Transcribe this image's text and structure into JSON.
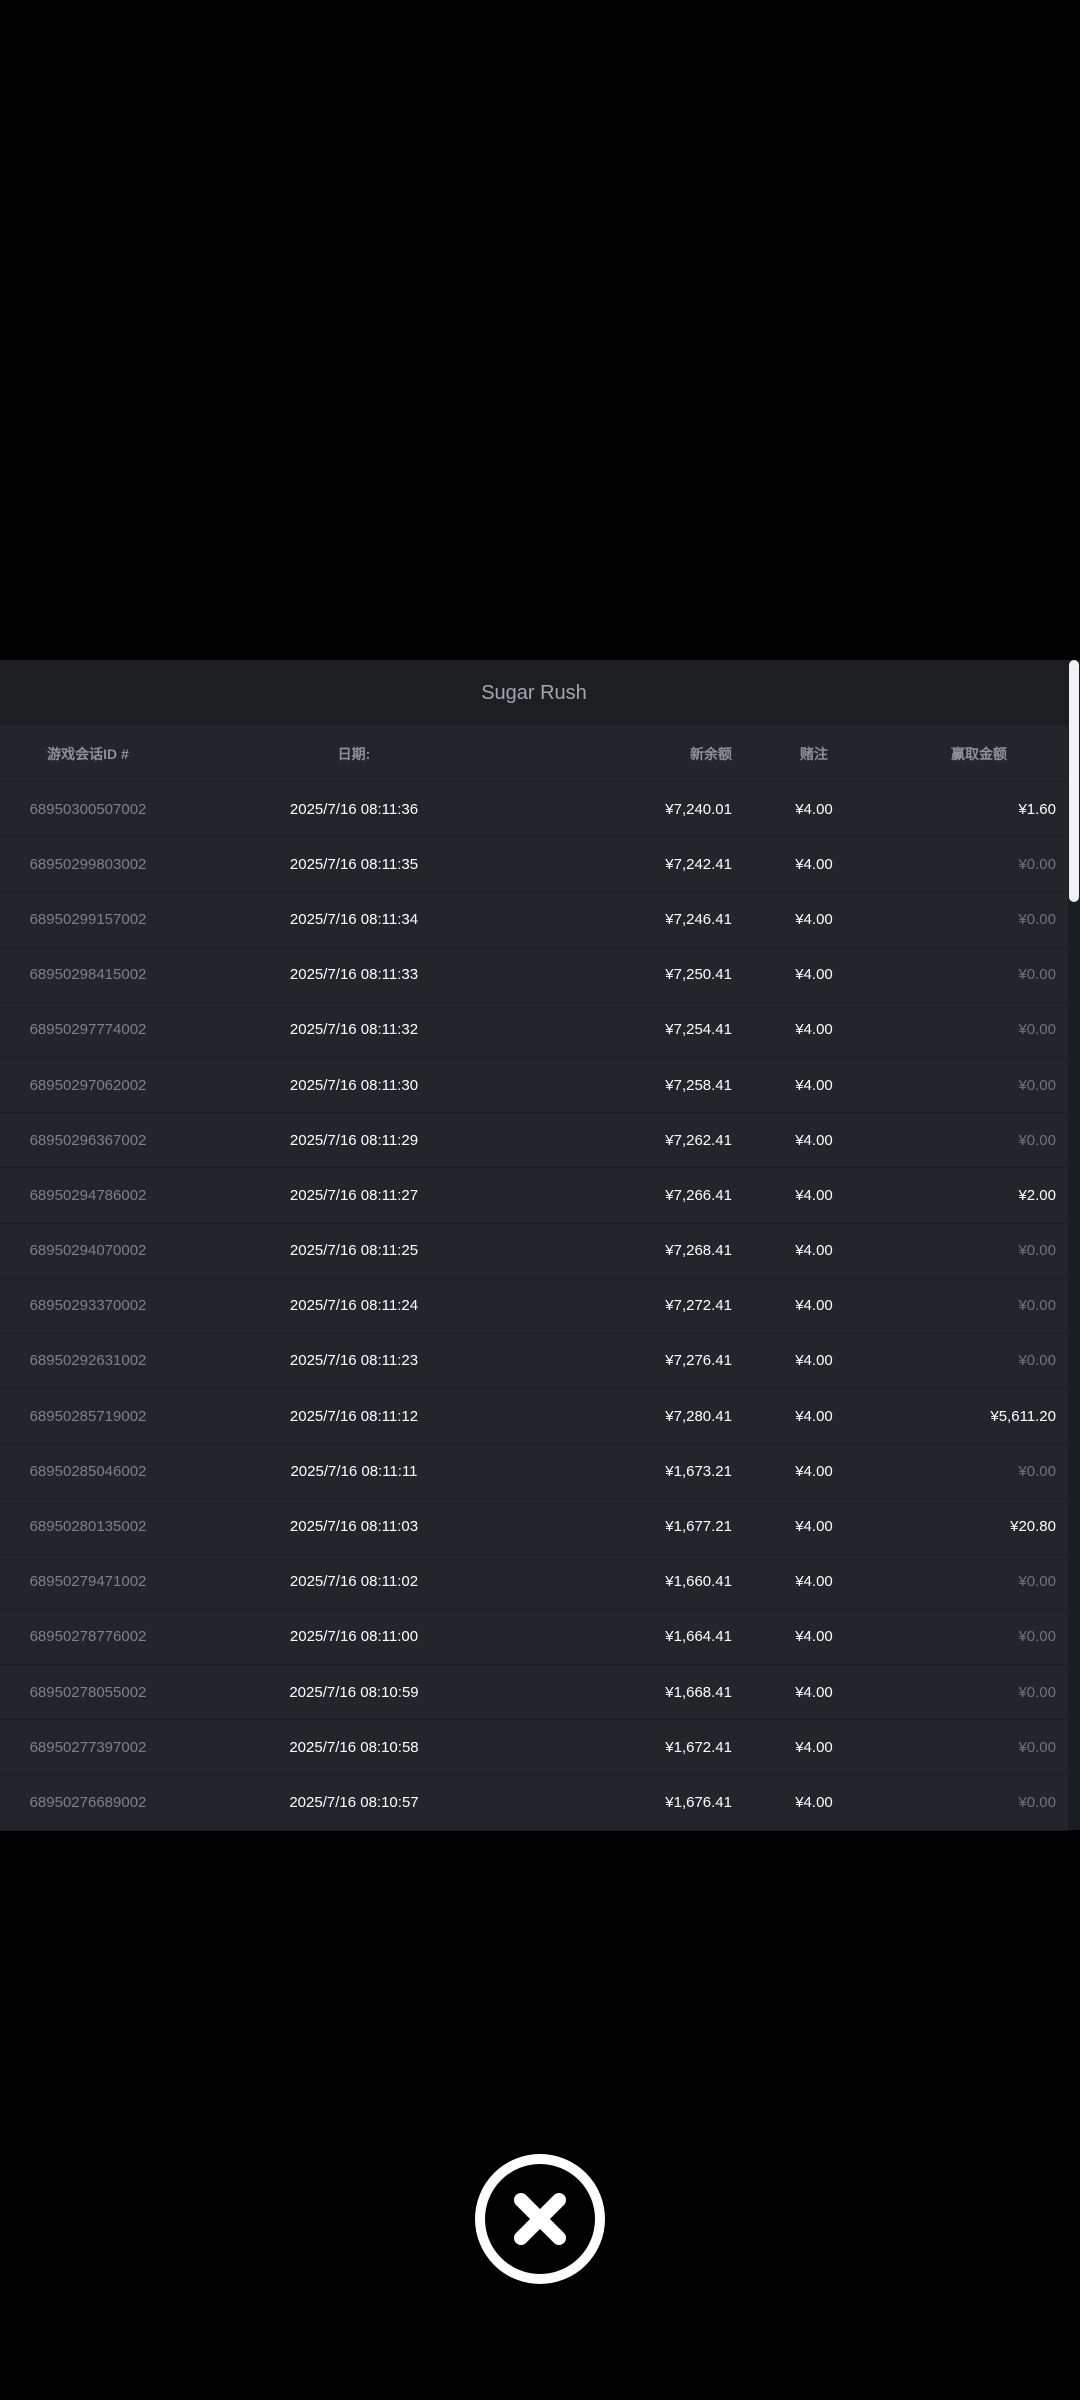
{
  "game_title": "Sugar Rush",
  "headers": {
    "session_id": "游戏会话ID #",
    "date": "日期:",
    "new_balance": "新余额",
    "bet": "赌注",
    "win": "赢取金额"
  },
  "rows": [
    {
      "id": "68950300507002",
      "date": "2025/7/16 08:11:36",
      "balance": "¥7,240.01",
      "bet": "¥4.00",
      "win": "¥1.60"
    },
    {
      "id": "68950299803002",
      "date": "2025/7/16 08:11:35",
      "balance": "¥7,242.41",
      "bet": "¥4.00",
      "win": "¥0.00"
    },
    {
      "id": "68950299157002",
      "date": "2025/7/16 08:11:34",
      "balance": "¥7,246.41",
      "bet": "¥4.00",
      "win": "¥0.00"
    },
    {
      "id": "68950298415002",
      "date": "2025/7/16 08:11:33",
      "balance": "¥7,250.41",
      "bet": "¥4.00",
      "win": "¥0.00"
    },
    {
      "id": "68950297774002",
      "date": "2025/7/16 08:11:32",
      "balance": "¥7,254.41",
      "bet": "¥4.00",
      "win": "¥0.00"
    },
    {
      "id": "68950297062002",
      "date": "2025/7/16 08:11:30",
      "balance": "¥7,258.41",
      "bet": "¥4.00",
      "win": "¥0.00"
    },
    {
      "id": "68950296367002",
      "date": "2025/7/16 08:11:29",
      "balance": "¥7,262.41",
      "bet": "¥4.00",
      "win": "¥0.00"
    },
    {
      "id": "68950294786002",
      "date": "2025/7/16 08:11:27",
      "balance": "¥7,266.41",
      "bet": "¥4.00",
      "win": "¥2.00"
    },
    {
      "id": "68950294070002",
      "date": "2025/7/16 08:11:25",
      "balance": "¥7,268.41",
      "bet": "¥4.00",
      "win": "¥0.00"
    },
    {
      "id": "68950293370002",
      "date": "2025/7/16 08:11:24",
      "balance": "¥7,272.41",
      "bet": "¥4.00",
      "win": "¥0.00"
    },
    {
      "id": "68950292631002",
      "date": "2025/7/16 08:11:23",
      "balance": "¥7,276.41",
      "bet": "¥4.00",
      "win": "¥0.00"
    },
    {
      "id": "68950285719002",
      "date": "2025/7/16 08:11:12",
      "balance": "¥7,280.41",
      "bet": "¥4.00",
      "win": "¥5,611.20"
    },
    {
      "id": "68950285046002",
      "date": "2025/7/16 08:11:11",
      "balance": "¥1,673.21",
      "bet": "¥4.00",
      "win": "¥0.00"
    },
    {
      "id": "68950280135002",
      "date": "2025/7/16 08:11:03",
      "balance": "¥1,677.21",
      "bet": "¥4.00",
      "win": "¥20.80"
    },
    {
      "id": "68950279471002",
      "date": "2025/7/16 08:11:02",
      "balance": "¥1,660.41",
      "bet": "¥4.00",
      "win": "¥0.00"
    },
    {
      "id": "68950278776002",
      "date": "2025/7/16 08:11:00",
      "balance": "¥1,664.41",
      "bet": "¥4.00",
      "win": "¥0.00"
    },
    {
      "id": "68950278055002",
      "date": "2025/7/16 08:10:59",
      "balance": "¥1,668.41",
      "bet": "¥4.00",
      "win": "¥0.00"
    },
    {
      "id": "68950277397002",
      "date": "2025/7/16 08:10:58",
      "balance": "¥1,672.41",
      "bet": "¥4.00",
      "win": "¥0.00"
    },
    {
      "id": "68950276689002",
      "date": "2025/7/16 08:10:57",
      "balance": "¥1,676.41",
      "bet": "¥4.00",
      "win": "¥0.00"
    }
  ],
  "colors": {
    "panel": "#22262a",
    "title_bar": "#1c1e21",
    "muted_text": "#7d8186"
  },
  "close_icon": "close-x-circle-icon"
}
